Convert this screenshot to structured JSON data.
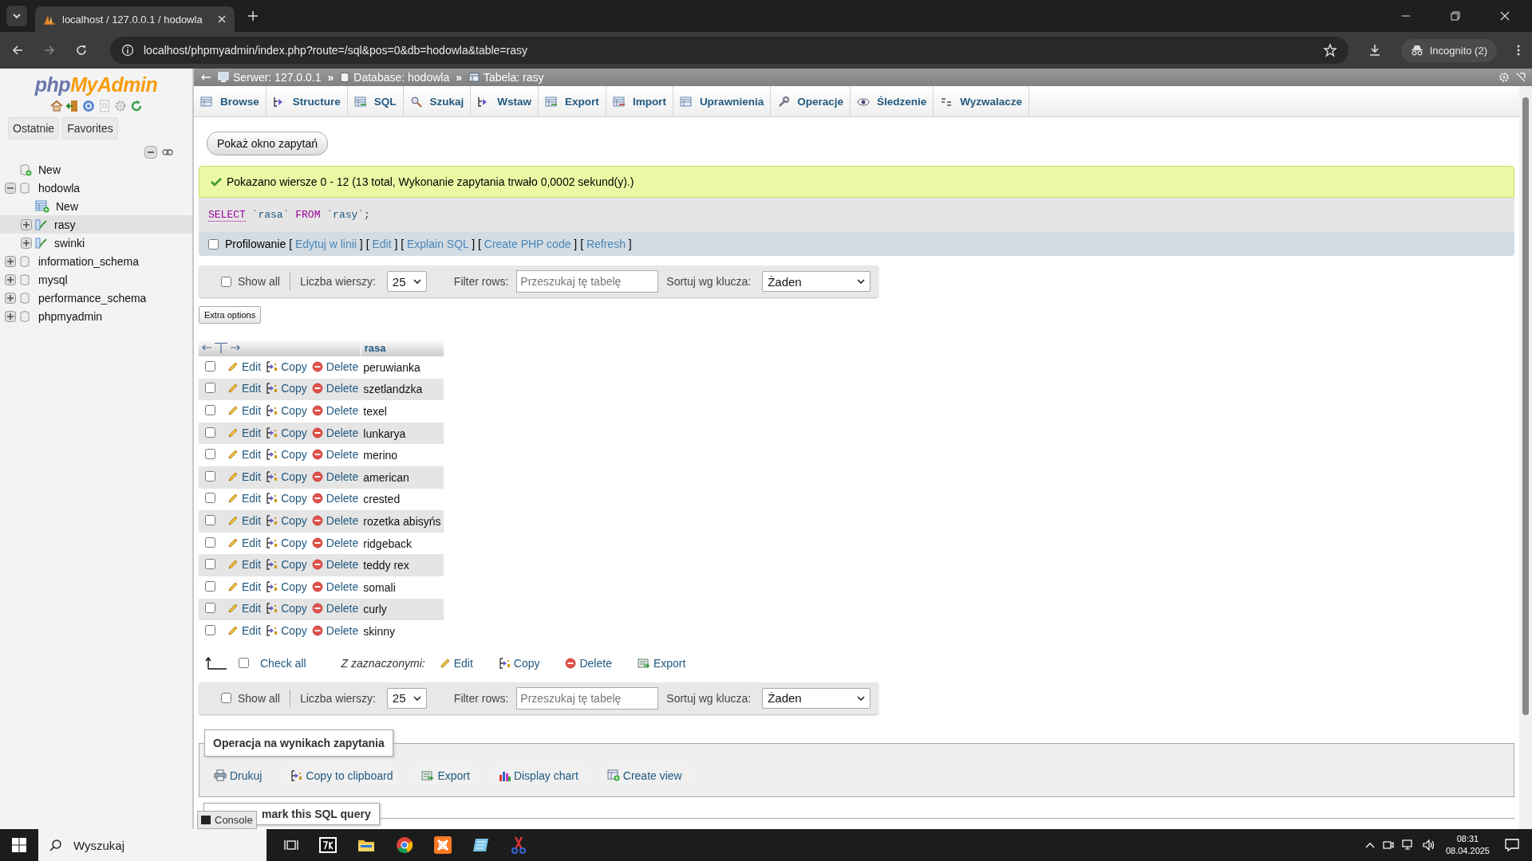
{
  "browser": {
    "tab_title": "localhost / 127.0.0.1 / hodowla",
    "url": "localhost/phpmyadmin/index.php?route=/sql&pos=0&db=hodowla&table=rasy",
    "profile": "Incognito (2)"
  },
  "sidebar": {
    "logo": [
      "php",
      "MyAdmin"
    ],
    "tabs": [
      {
        "label": "Ostatnie",
        "selected": false
      },
      {
        "label": "Favorites",
        "selected": false
      }
    ],
    "tree": [
      {
        "label": "New",
        "kind": "new-db",
        "selected": false
      },
      {
        "label": "hodowla",
        "kind": "database",
        "expanded": true,
        "selected": false,
        "children": [
          {
            "label": "New",
            "kind": "new-table",
            "selected": false
          },
          {
            "label": "rasy",
            "kind": "table",
            "expanded": false,
            "selected": true
          },
          {
            "label": "swinki",
            "kind": "table",
            "expanded": false,
            "selected": false
          }
        ]
      },
      {
        "label": "information_schema",
        "kind": "database",
        "expanded": false,
        "selected": false
      },
      {
        "label": "mysql",
        "kind": "database",
        "expanded": false,
        "selected": false
      },
      {
        "label": "performance_schema",
        "kind": "database",
        "expanded": false,
        "selected": false
      },
      {
        "label": "phpmyadmin",
        "kind": "database",
        "expanded": false,
        "selected": false
      }
    ]
  },
  "breadcrumb": [
    {
      "label": "Serwer: 127.0.0.1",
      "kind": "server"
    },
    {
      "separator": "»",
      "label": "Database: hodowla",
      "kind": "database"
    },
    {
      "separator": "»",
      "label": "Tabela: rasy",
      "kind": "table"
    }
  ],
  "tabs": [
    {
      "label": "Browse",
      "kind": "browse",
      "selected": false
    },
    {
      "label": "Structure",
      "kind": "structure",
      "selected": false
    },
    {
      "label": "SQL",
      "kind": "sql",
      "selected": false
    },
    {
      "label": "Szukaj",
      "kind": "search",
      "selected": false
    },
    {
      "label": "Wstaw",
      "kind": "insert",
      "selected": false
    },
    {
      "label": "Export",
      "kind": "export",
      "selected": false
    },
    {
      "label": "Import",
      "kind": "import",
      "selected": false
    },
    {
      "label": "Uprawnienia",
      "kind": "privileges",
      "selected": false
    },
    {
      "label": "Operacje",
      "kind": "operations",
      "selected": false
    },
    {
      "label": "Śledzenie",
      "kind": "tracking",
      "selected": false
    },
    {
      "label": "Wyzwalacze",
      "kind": "triggers",
      "selected": false
    }
  ],
  "show_query_button": "Pokaż okno zapytań",
  "message": "Pokazano wiersze 0 - 12 (13 total, Wykonanie zapytania trwało 0,0002 sekund(y).)",
  "sql": [
    {
      "text": "SELECT",
      "kind": "keyword-link"
    },
    {
      "text": "`rasa`",
      "kind": "identifier"
    },
    {
      "text": "FROM",
      "kind": "keyword"
    },
    {
      "text": "`rasy`",
      "kind": "identifier"
    },
    {
      "text": ";",
      "kind": "punct"
    }
  ],
  "profiling": {
    "label": "Profilowanie",
    "checked": false,
    "links": [
      {
        "open": "[",
        "label": "Edytuj w linii",
        "close": "]"
      },
      {
        "open": "[",
        "label": "Edit",
        "close": "]"
      },
      {
        "open": "[",
        "label": "Explain SQL",
        "close": "]"
      },
      {
        "open": "[",
        "label": "Create PHP code",
        "close": "]"
      },
      {
        "open": "[",
        "label": "Refresh",
        "close": "]"
      }
    ]
  },
  "nav_top": {
    "show_all": "Show all",
    "checked": false,
    "rows_label": "Liczba wierszy:",
    "rows_value": "25",
    "filter_label": "Filter rows:",
    "filter_placeholder": "Przeszukaj tę tabelę",
    "sort_label": "Sortuj wg klucza:",
    "sort_value": "Żaden"
  },
  "extra_options": "Extra options",
  "table": {
    "column": "rasa",
    "rows": [
      {
        "value": "peruwianka",
        "checked": false,
        "actions": [
          "Edit",
          "Copy",
          "Delete"
        ]
      },
      {
        "value": "szetlandzka",
        "checked": false,
        "actions": [
          "Edit",
          "Copy",
          "Delete"
        ]
      },
      {
        "value": "texel",
        "checked": false,
        "actions": [
          "Edit",
          "Copy",
          "Delete"
        ]
      },
      {
        "value": "lunkarya",
        "checked": false,
        "actions": [
          "Edit",
          "Copy",
          "Delete"
        ]
      },
      {
        "value": "merino",
        "checked": false,
        "actions": [
          "Edit",
          "Copy",
          "Delete"
        ]
      },
      {
        "value": "american",
        "checked": false,
        "actions": [
          "Edit",
          "Copy",
          "Delete"
        ]
      },
      {
        "value": "crested",
        "checked": false,
        "actions": [
          "Edit",
          "Copy",
          "Delete"
        ]
      },
      {
        "value": "rozetka abisyńs",
        "checked": false,
        "actions": [
          "Edit",
          "Copy",
          "Delete"
        ]
      },
      {
        "value": "ridgeback",
        "checked": false,
        "actions": [
          "Edit",
          "Copy",
          "Delete"
        ]
      },
      {
        "value": "teddy rex",
        "checked": false,
        "actions": [
          "Edit",
          "Copy",
          "Delete"
        ]
      },
      {
        "value": "somali",
        "checked": false,
        "actions": [
          "Edit",
          "Copy",
          "Delete"
        ]
      },
      {
        "value": "curly",
        "checked": false,
        "actions": [
          "Edit",
          "Copy",
          "Delete"
        ]
      },
      {
        "value": "skinny",
        "checked": false,
        "actions": [
          "Edit",
          "Copy",
          "Delete"
        ]
      }
    ]
  },
  "bulk": {
    "check_all": "Check all",
    "checked": false,
    "with_selected": "Z zaznaczonymi:",
    "actions": [
      {
        "label": "Edit",
        "kind": "edit"
      },
      {
        "label": "Copy",
        "kind": "copy"
      },
      {
        "label": "Delete",
        "kind": "delete"
      },
      {
        "label": "Export",
        "kind": "export"
      }
    ]
  },
  "nav_bottom": {
    "show_all": "Show all",
    "checked": false,
    "rows_label": "Liczba wierszy:",
    "rows_value": "25",
    "filter_label": "Filter rows:",
    "filter_placeholder": "Przeszukaj tę tabelę",
    "sort_label": "Sortuj wg klucza:",
    "sort_value": "Żaden"
  },
  "operations": {
    "legend": "Operacja na wynikach zapytania",
    "buttons": [
      {
        "label": "Drukuj",
        "kind": "print"
      },
      {
        "label": "Copy to clipboard",
        "kind": "copy"
      },
      {
        "label": "Export",
        "kind": "export"
      },
      {
        "label": "Display chart",
        "kind": "chart"
      },
      {
        "label": "Create view",
        "kind": "view"
      }
    ]
  },
  "bookmark_legend": "mark this SQL query",
  "console": "Console",
  "taskbar": {
    "search": "Wyszukaj",
    "time": "08:31",
    "date": "08.04.2025"
  }
}
